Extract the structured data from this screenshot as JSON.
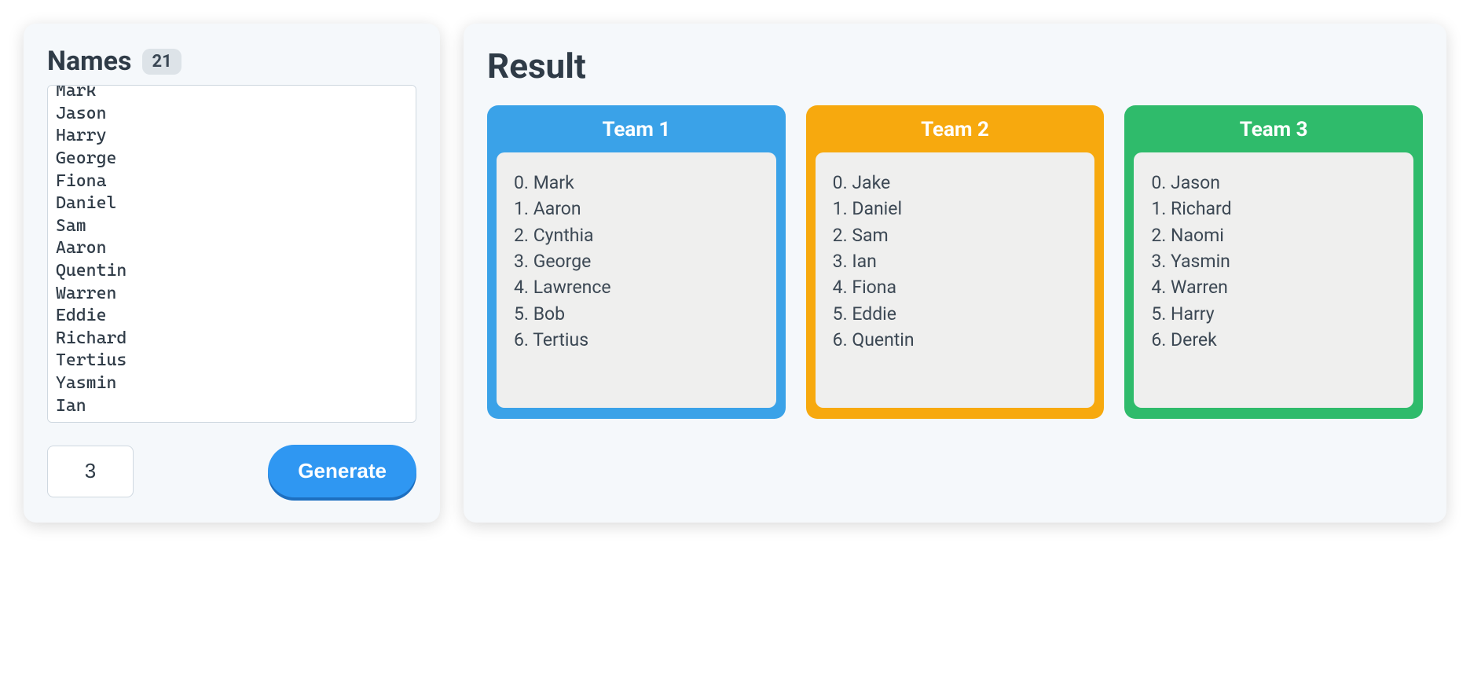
{
  "colors": {
    "team_palette": [
      "#3aa2e8",
      "#f7a90e",
      "#2fbb6b"
    ]
  },
  "input": {
    "title": "Names",
    "count": "21",
    "names_text": "Bob\nNaomi\nMark\nJason\nHarry\nGeorge\nFiona\nDaniel\nSam\nAaron\nQuentin\nWarren\nEddie\nRichard\nTertius\nYasmin\nIan",
    "team_count_value": "3",
    "generate_label": "Generate"
  },
  "result": {
    "title": "Result",
    "teams": [
      {
        "name": "Team 1",
        "members": [
          "Mark",
          "Aaron",
          "Cynthia",
          "George",
          "Lawrence",
          "Bob",
          "Tertius"
        ]
      },
      {
        "name": "Team 2",
        "members": [
          "Jake",
          "Daniel",
          "Sam",
          "Ian",
          "Fiona",
          "Eddie",
          "Quentin"
        ]
      },
      {
        "name": "Team 3",
        "members": [
          "Jason",
          "Richard",
          "Naomi",
          "Yasmin",
          "Warren",
          "Harry",
          "Derek"
        ]
      }
    ]
  }
}
